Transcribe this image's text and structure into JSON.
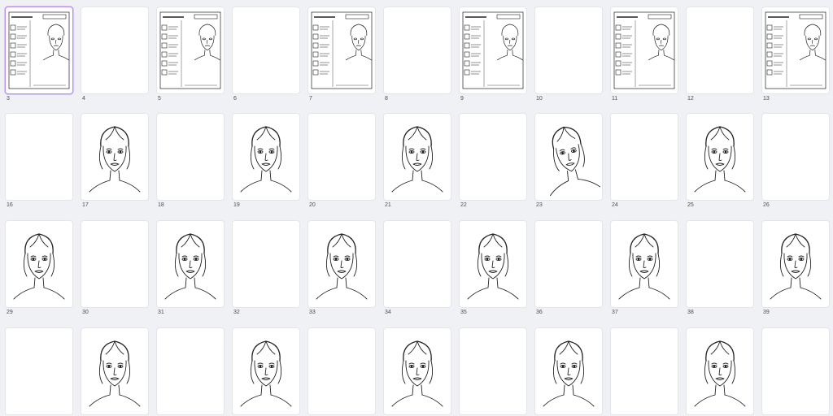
{
  "selected_page": "3",
  "rows": [
    {
      "pages": [
        {
          "label": "3",
          "kind": "sheet"
        },
        {
          "label": "4",
          "kind": "blank"
        },
        {
          "label": "5",
          "kind": "sheet"
        },
        {
          "label": "6",
          "kind": "blank"
        },
        {
          "label": "7",
          "kind": "sheet"
        },
        {
          "label": "8",
          "kind": "blank"
        },
        {
          "label": "9",
          "kind": "sheet"
        },
        {
          "label": "10",
          "kind": "blank"
        },
        {
          "label": "11",
          "kind": "sheet"
        },
        {
          "label": "12",
          "kind": "blank"
        },
        {
          "label": "13",
          "kind": "sheet"
        }
      ]
    },
    {
      "pages": [
        {
          "label": "16",
          "kind": "blank"
        },
        {
          "label": "17",
          "kind": "face"
        },
        {
          "label": "18",
          "kind": "blank"
        },
        {
          "label": "19",
          "kind": "face"
        },
        {
          "label": "20",
          "kind": "blank"
        },
        {
          "label": "21",
          "kind": "face"
        },
        {
          "label": "22",
          "kind": "blank"
        },
        {
          "label": "23",
          "kind": "face-tilted"
        },
        {
          "label": "24",
          "kind": "blank"
        },
        {
          "label": "25",
          "kind": "face"
        },
        {
          "label": "26",
          "kind": "blank"
        }
      ]
    },
    {
      "pages": [
        {
          "label": "29",
          "kind": "face"
        },
        {
          "label": "30",
          "kind": "blank"
        },
        {
          "label": "31",
          "kind": "face"
        },
        {
          "label": "32",
          "kind": "blank"
        },
        {
          "label": "33",
          "kind": "face"
        },
        {
          "label": "34",
          "kind": "blank"
        },
        {
          "label": "35",
          "kind": "face"
        },
        {
          "label": "36",
          "kind": "blank"
        },
        {
          "label": "37",
          "kind": "face"
        },
        {
          "label": "38",
          "kind": "blank"
        },
        {
          "label": "39",
          "kind": "face"
        }
      ]
    },
    {
      "pages": [
        {
          "label": "",
          "kind": "blank"
        },
        {
          "label": "",
          "kind": "face"
        },
        {
          "label": "",
          "kind": "blank"
        },
        {
          "label": "",
          "kind": "face"
        },
        {
          "label": "",
          "kind": "blank"
        },
        {
          "label": "",
          "kind": "face"
        },
        {
          "label": "",
          "kind": "blank"
        },
        {
          "label": "",
          "kind": "face"
        },
        {
          "label": "",
          "kind": "blank"
        },
        {
          "label": "",
          "kind": "face"
        },
        {
          "label": "",
          "kind": "blank"
        }
      ]
    }
  ],
  "colors": {
    "background": "#f0f1f5",
    "page": "#ffffff",
    "selection": "#b58cf0",
    "ink": "#222222"
  },
  "icons": {
    "face": "face-line-art-icon",
    "sheet": "makeup-practice-sheet-icon"
  }
}
